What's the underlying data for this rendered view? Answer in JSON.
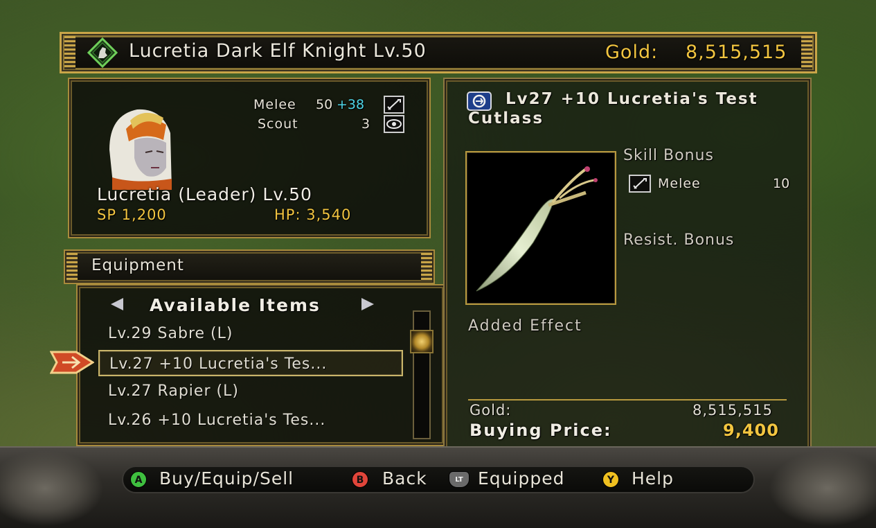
{
  "header": {
    "character_title": "Lucretia Dark Elf Knight Lv.50",
    "gold_label": "Gold:",
    "gold_value": "8,515,515"
  },
  "character": {
    "name_line": "Lucretia (Leader) Lv.50",
    "sp": "SP 1,200",
    "hp": "HP: 3,540",
    "skills": [
      {
        "name": "Melee",
        "base": "50",
        "bonus": "+38",
        "icon": "sword-icon"
      },
      {
        "name": "Scout",
        "base": "3",
        "bonus": "",
        "icon": "eye-icon"
      }
    ]
  },
  "equipment": {
    "label": "Equipment",
    "list_title": "Available Items",
    "items": [
      "Lv.29 Sabre (L)",
      "Lv.27 +10 Lucretia's Tes...",
      "Lv.27 Rapier (L)",
      "Lv.26 +10 Lucretia's Tes..."
    ],
    "selected_index": 1
  },
  "detail": {
    "item_name_line1": "Lv27 +10 Lucretia's Test",
    "item_name_line2": "Cutlass",
    "skill_bonus_label": "Skill Bonus",
    "skill_bonus_name": "Melee",
    "skill_bonus_value": "10",
    "resist_bonus_label": "Resist. Bonus",
    "added_effect_label": "Added Effect",
    "gold_label": "Gold:",
    "gold_value": "8,515,515",
    "price_label": "Buying Price:",
    "price_value": "9,400"
  },
  "controls": [
    {
      "button": "A",
      "label": "Buy/Equip/Sell",
      "color": "#3fbf3f"
    },
    {
      "button": "B",
      "label": "Back",
      "color": "#e0453a"
    },
    {
      "button": "LT",
      "label": "Equipped",
      "color": "#6a6a6a"
    },
    {
      "button": "Y",
      "label": "Help",
      "color": "#f0c020"
    }
  ],
  "colors": {
    "gold_text": "#f2c540",
    "bonus_text": "#4fd6e8",
    "frame_gold": "#a88a3c"
  }
}
